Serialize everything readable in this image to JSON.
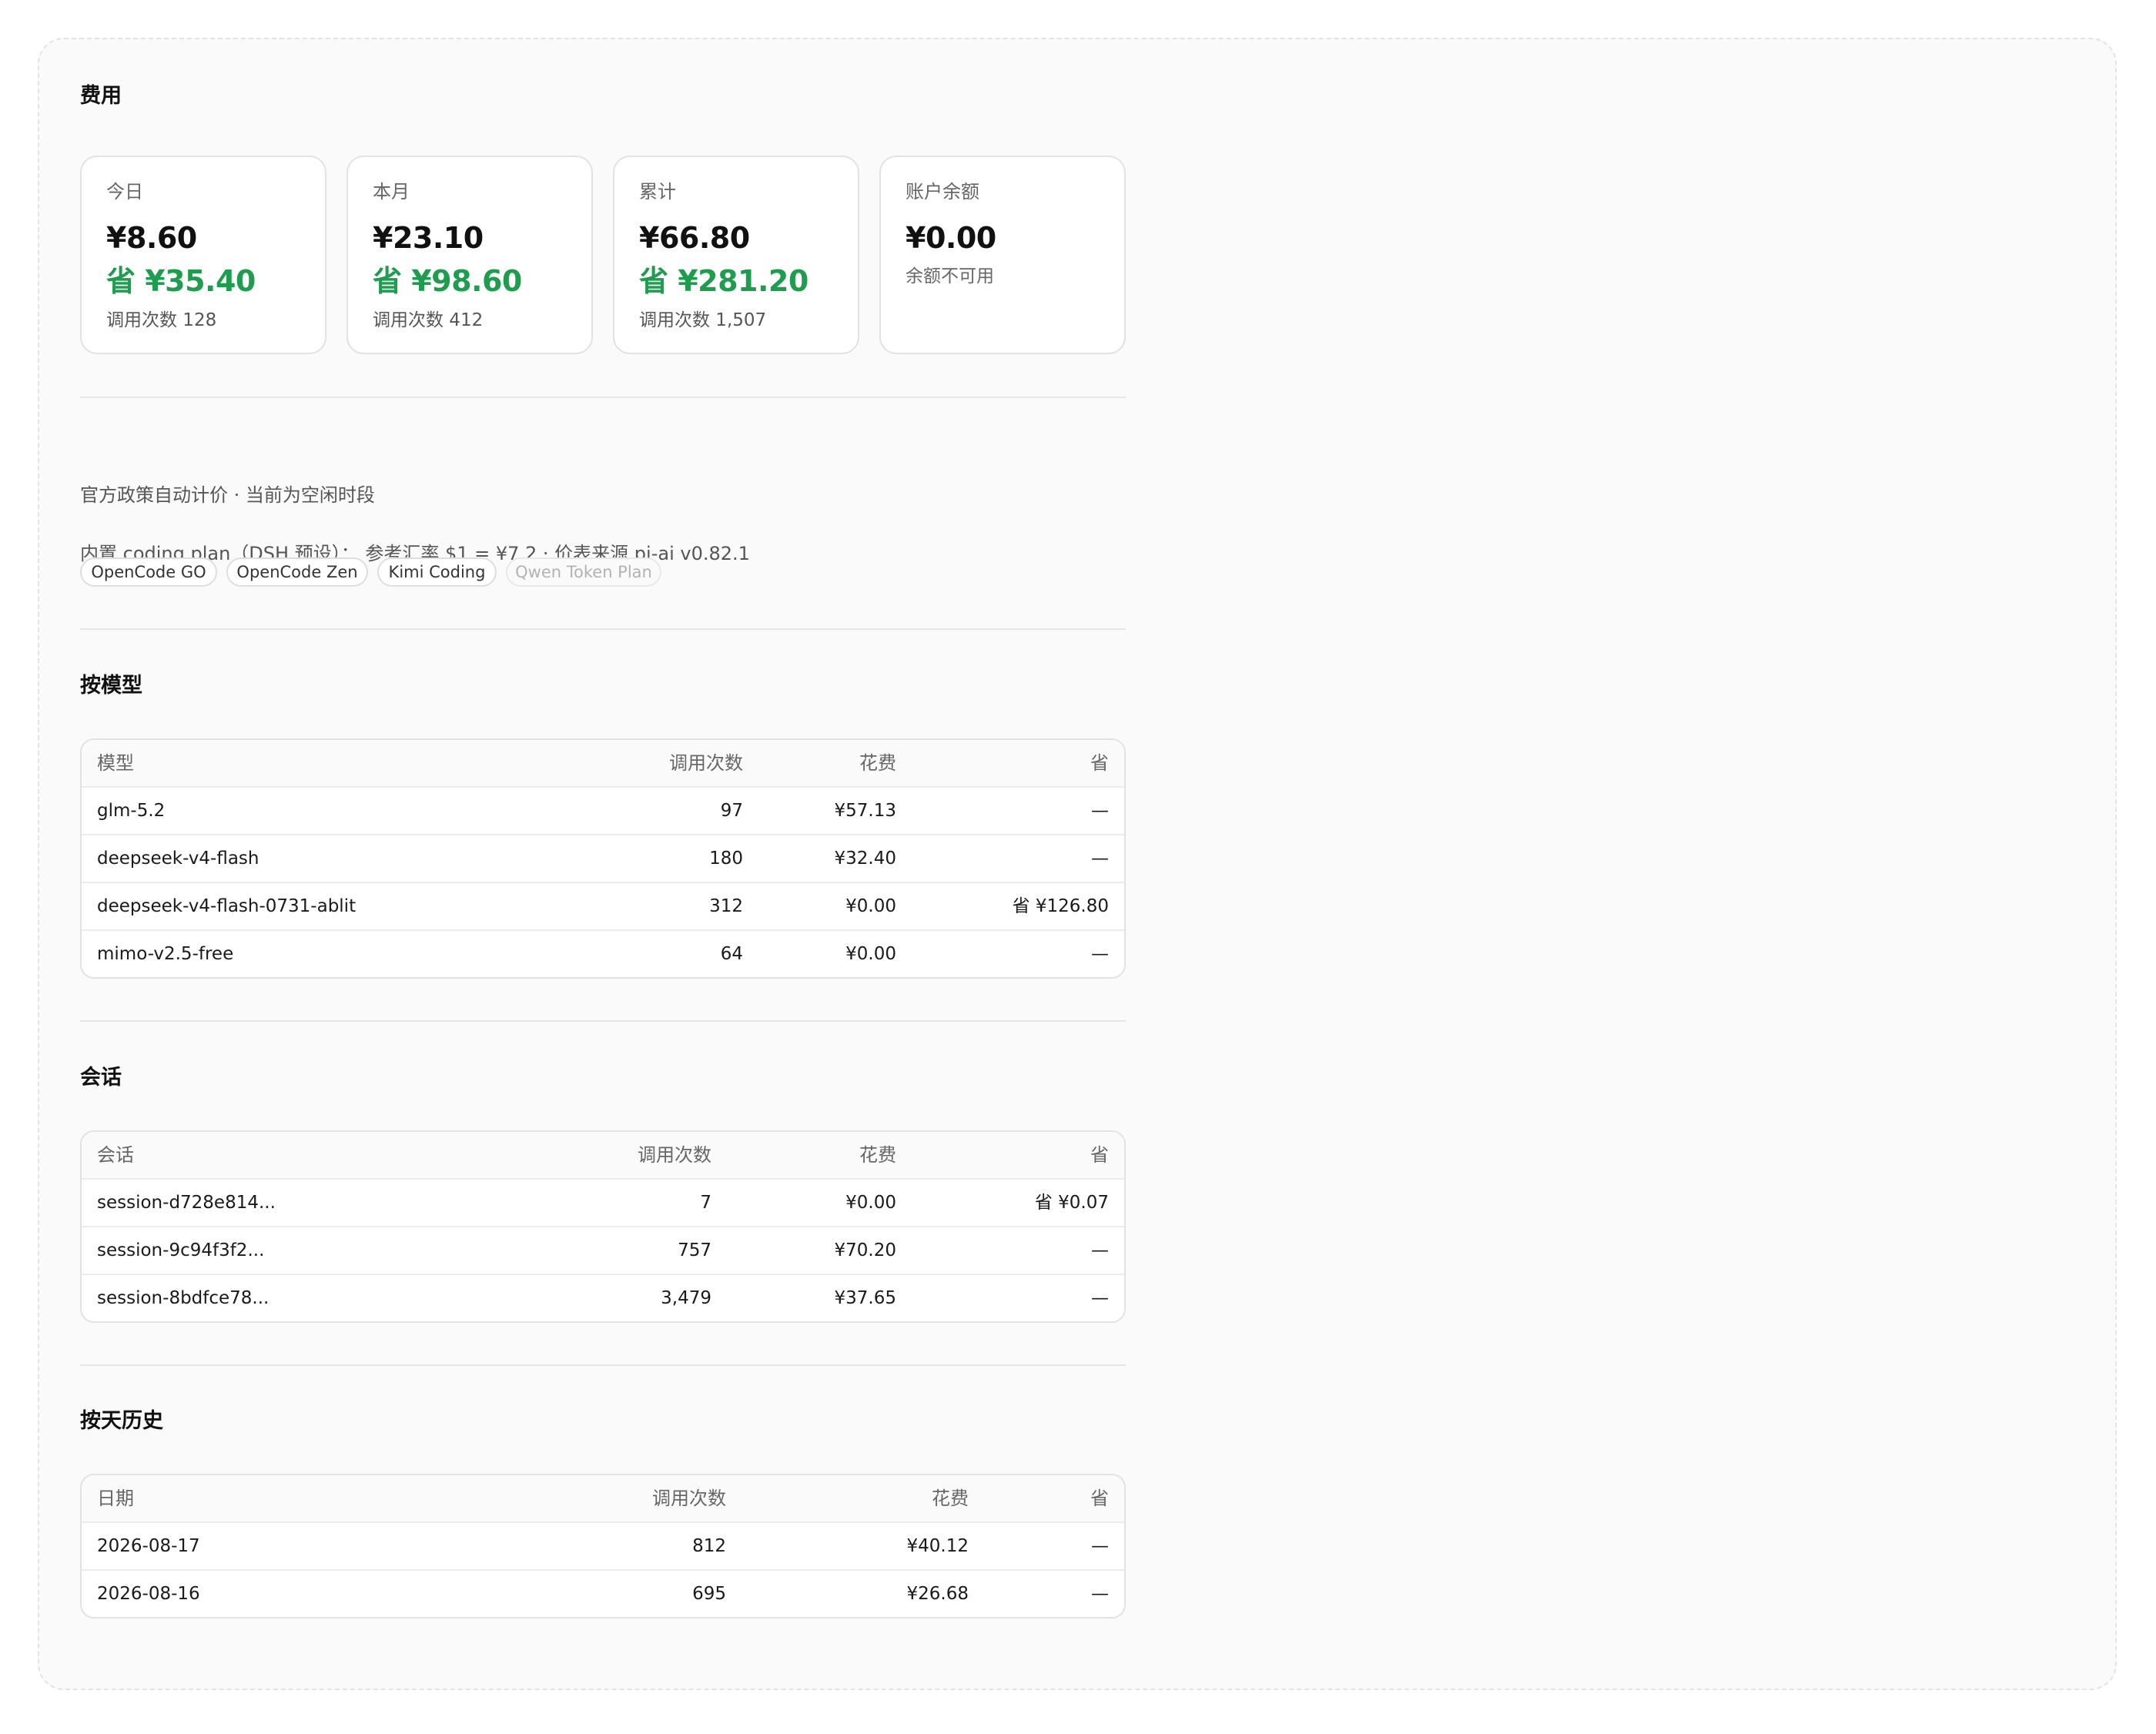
{
  "cost": {
    "title": "费用",
    "cards": [
      {
        "label": "今日",
        "amount": "¥8.60",
        "saved": "省 ¥35.40",
        "calls": "调用次数 128"
      },
      {
        "label": "本月",
        "amount": "¥23.10",
        "saved": "省 ¥98.60",
        "calls": "调用次数 412"
      },
      {
        "label": "累计",
        "amount": "¥66.80",
        "saved": "省 ¥281.20",
        "calls": "调用次数 1,507"
      },
      {
        "label": "账户余额",
        "amount": "¥0.00",
        "note": "余额不可用"
      }
    ],
    "policy_text": "官方政策自动计价 · 当前为空闲时段",
    "plan_text": "内置 coding plan（DSH 预设）： 参考汇率 $1 = ¥7.2 · 价表来源 pi-ai v0.82.1",
    "plans": [
      {
        "label": "OpenCode GO",
        "active": true
      },
      {
        "label": "OpenCode Zen",
        "active": true
      },
      {
        "label": "Kimi Coding",
        "active": true
      },
      {
        "label": "Qwen Token Plan",
        "active": false
      }
    ]
  },
  "by_model": {
    "title": "按模型",
    "headers": {
      "name": "模型",
      "calls": "调用次数",
      "cost": "花费",
      "saved": "省"
    },
    "rows": [
      {
        "name": "glm-5.2",
        "calls": "97",
        "cost": "¥57.13",
        "saved": "—"
      },
      {
        "name": "deepseek-v4-flash",
        "calls": "180",
        "cost": "¥32.40",
        "saved": "—"
      },
      {
        "name": "deepseek-v4-flash-0731-ablit",
        "calls": "312",
        "cost": "¥0.00",
        "saved": "省 ¥126.80"
      },
      {
        "name": "mimo-v2.5-free",
        "calls": "64",
        "cost": "¥0.00",
        "saved": "—"
      }
    ]
  },
  "sessions": {
    "title": "会话",
    "headers": {
      "name": "会话",
      "calls": "调用次数",
      "cost": "花费",
      "saved": "省"
    },
    "rows": [
      {
        "name": "session-d728e814...",
        "calls": "7",
        "cost": "¥0.00",
        "saved": "省 ¥0.07"
      },
      {
        "name": "session-9c94f3f2...",
        "calls": "757",
        "cost": "¥70.20",
        "saved": "—"
      },
      {
        "name": "session-8bdfce78...",
        "calls": "3,479",
        "cost": "¥37.65",
        "saved": "—"
      }
    ]
  },
  "by_day": {
    "title": "按天历史",
    "headers": {
      "name": "日期",
      "calls": "调用次数",
      "cost": "花费",
      "saved": "省"
    },
    "rows": [
      {
        "name": "2026-08-17",
        "calls": "812",
        "cost": "¥40.12",
        "saved": "—"
      },
      {
        "name": "2026-08-16",
        "calls": "695",
        "cost": "¥26.68",
        "saved": "—"
      }
    ]
  }
}
